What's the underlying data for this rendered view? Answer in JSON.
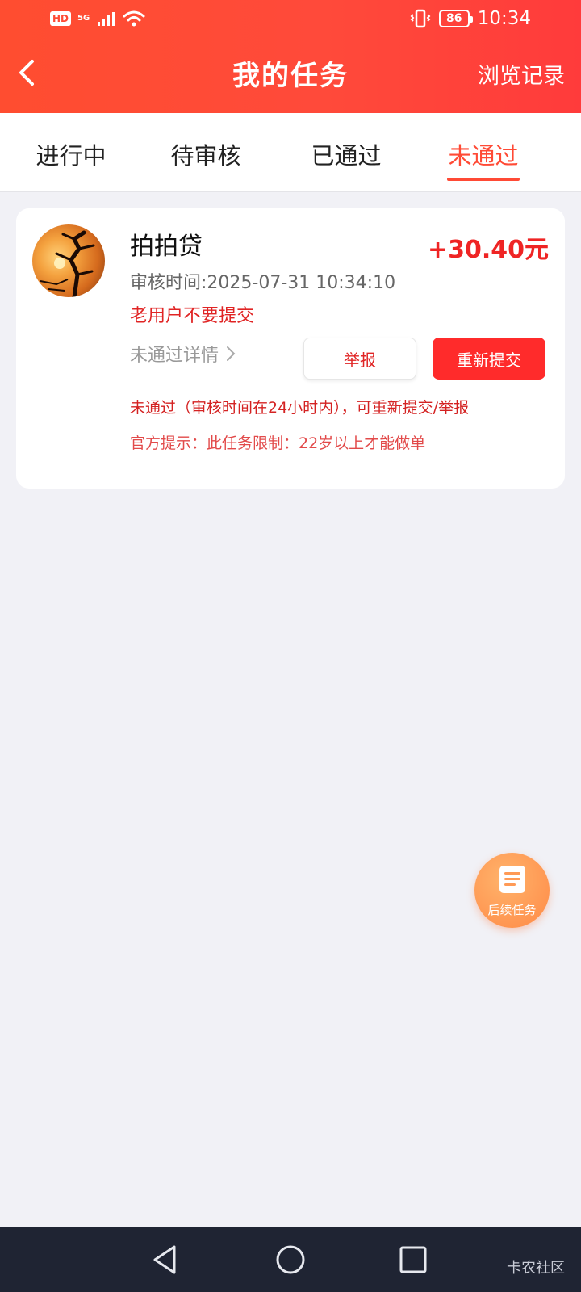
{
  "status_bar": {
    "hd": "HD",
    "network": "5G",
    "battery": "86",
    "time": "10:34"
  },
  "nav": {
    "title": "我的任务",
    "history_link": "浏览记录"
  },
  "tabs": [
    "进行中",
    "待审核",
    "已通过",
    "未通过"
  ],
  "active_tab": 3,
  "task": {
    "name": "拍拍贷",
    "reward": "+30.40元",
    "review_time": "审核时间:2025-07-31 10:34:10",
    "note": "老用户不要提交",
    "detail_link": "未通过详情",
    "report_label": "举报",
    "resubmit_label": "重新提交",
    "status_text": "未通过（审核时间在24小时内），可重新提交/举报",
    "official_tip": "官方提示：此任务限制：22岁以上才能做单"
  },
  "fab": {
    "label": "后续任务",
    "icon": "document-list-icon"
  },
  "watermark": "卡农社区",
  "colors": {
    "header": "#ff4a34",
    "accent": "#ff4a35",
    "primary_button": "#ff2b2b",
    "warning_text": "#e02424",
    "nav_bar": "#1f2433"
  }
}
